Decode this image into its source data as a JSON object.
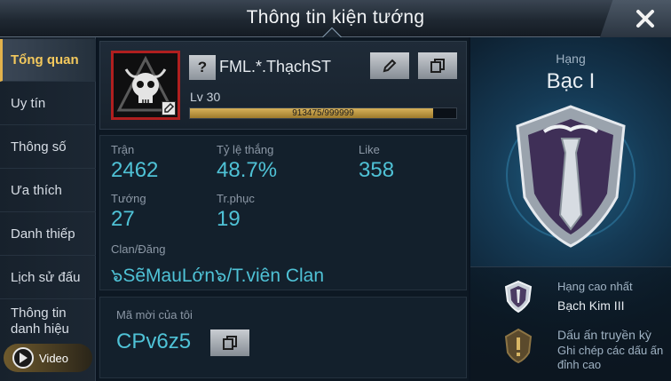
{
  "header": {
    "title": "Thông tin kiện tướng"
  },
  "sidebar": {
    "items": [
      {
        "label": "Tổng quan",
        "active": true
      },
      {
        "label": "Uy tín",
        "active": false
      },
      {
        "label": "Thông số",
        "active": false
      },
      {
        "label": "Ưa thích",
        "active": false
      },
      {
        "label": "Danh thiếp",
        "active": false
      },
      {
        "label": "Lịch sử đấu",
        "active": false
      },
      {
        "label": "Thông tin danh hiệu",
        "active": false
      }
    ],
    "video_label": "Video"
  },
  "profile": {
    "help_symbol": "?",
    "name": "FML.*.ThạchST",
    "level": "Lv 30",
    "xp_text": "913475/999999",
    "xp_fraction": 0.9135
  },
  "stats": {
    "matches_label": "Trận",
    "matches_value": "2462",
    "winrate_label": "Tỷ lệ thắng",
    "winrate_value": "48.7%",
    "like_label": "Like",
    "like_value": "358",
    "heroes_label": "Tướng",
    "heroes_value": "27",
    "skins_label": "Tr.phục",
    "skins_value": "19",
    "clan_label": "Clan/Đăng",
    "clan_value": "๖SẽMauLớn๖/T.viên Clan"
  },
  "invite": {
    "label": "Mã mời của tôi",
    "code": "CPv6z5"
  },
  "rank": {
    "label": "Hạng",
    "value": "Bạc I",
    "highest_label": "Hạng cao nhất",
    "highest_value": "Bạch Kim III",
    "mark_label": "Dấu ấn truyền kỳ",
    "mark_desc": "Ghi chép các dấu ấn đỉnh cao"
  },
  "colors": {
    "accent_gold": "#e2b24c",
    "stat_cyan": "#4fc2d6",
    "avatar_frame": "#b01f1f"
  }
}
